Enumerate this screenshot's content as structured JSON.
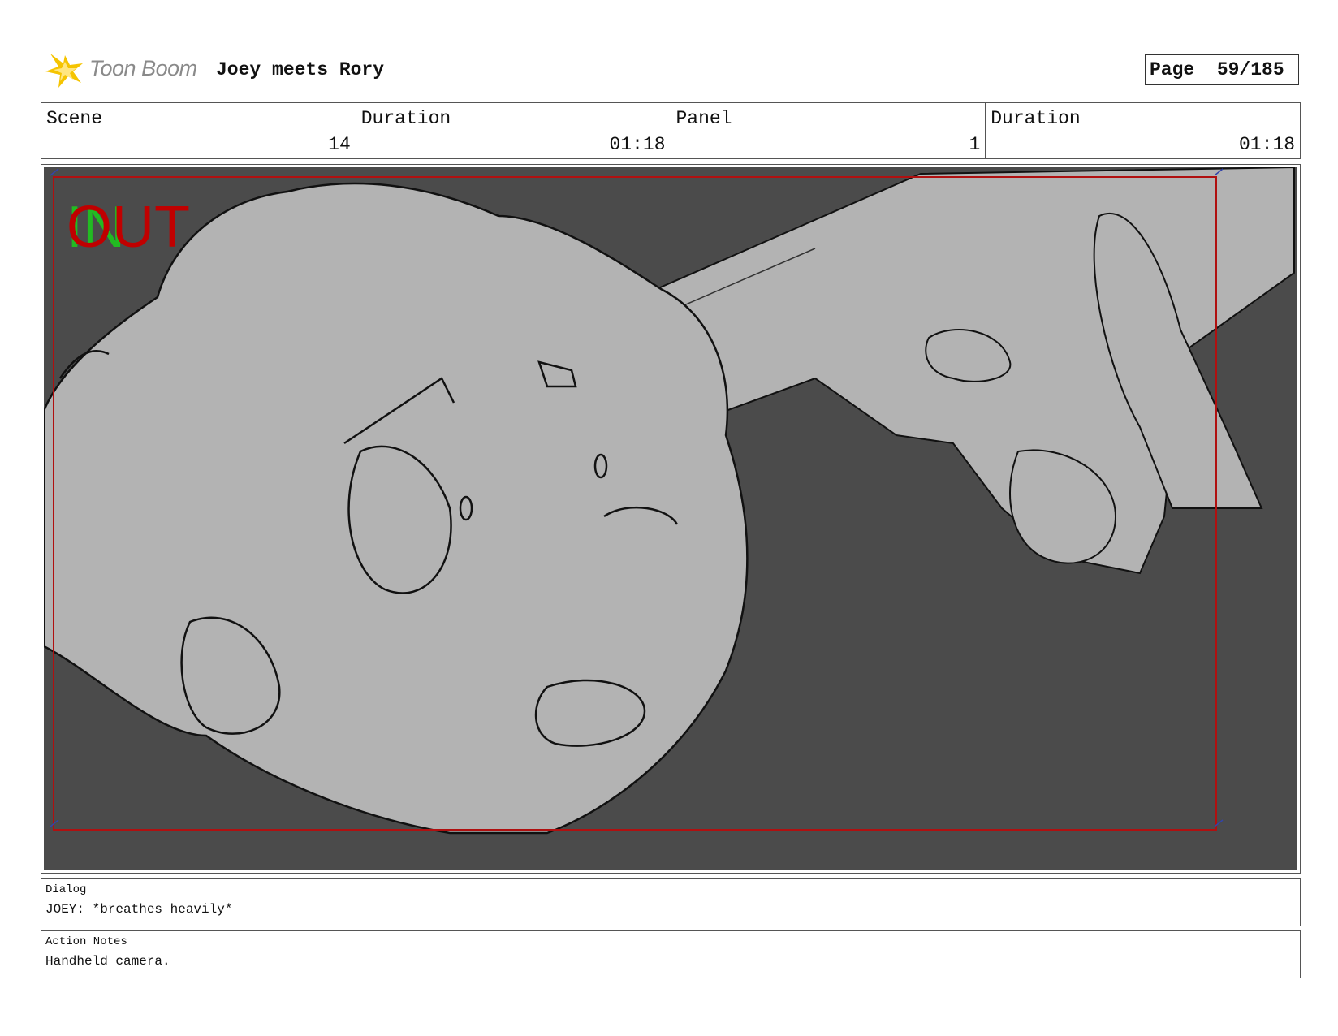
{
  "header": {
    "logo_text": "Toon Boom",
    "project_title": "Joey meets Rory",
    "page_label": "Page",
    "page_number": "59/185"
  },
  "info": {
    "scene_label": "Scene",
    "scene_value": "14",
    "scene_duration_label": "Duration",
    "scene_duration_value": "01:18",
    "panel_label": "Panel",
    "panel_value": "1",
    "panel_duration_label": "Duration",
    "panel_duration_value": "01:18"
  },
  "frame": {
    "marker_in": "IN",
    "marker_out": "OUT"
  },
  "dialog": {
    "label": "Dialog",
    "text": "JOEY: *breathes heavily*"
  },
  "action_notes": {
    "label": "Action Notes",
    "text": "Handheld camera."
  },
  "colors": {
    "background": "#4b4b4b",
    "figure": "#b3b3b3",
    "frame_border": "#b01010",
    "in_marker": "#22bb22",
    "out_marker": "#c00000",
    "logo_star": "#f5c400"
  }
}
